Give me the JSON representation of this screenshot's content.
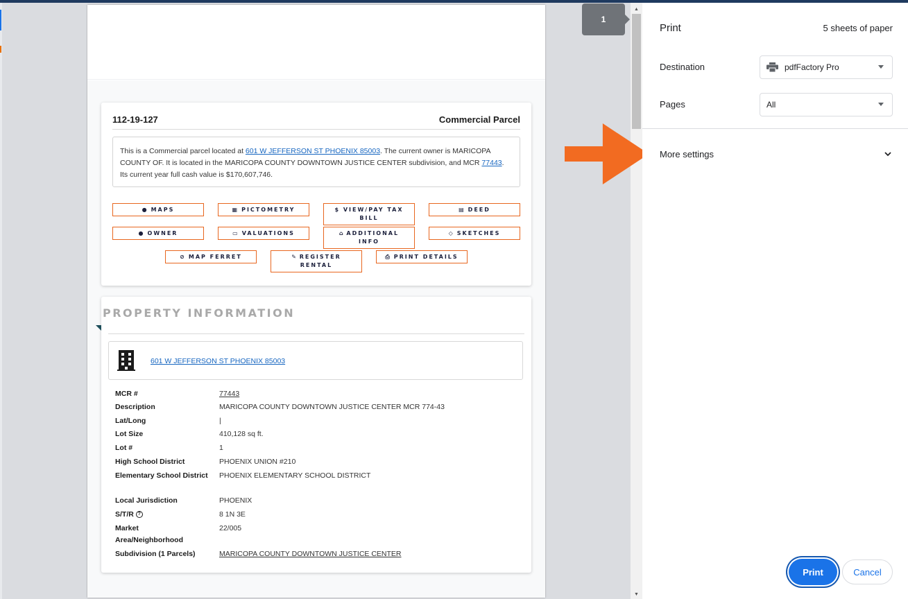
{
  "preview": {
    "parcel": {
      "number": "112-19-127",
      "type": "Commercial Parcel",
      "summary_pre": "This is a Commercial parcel located at ",
      "summary_address": "601 W JEFFERSON ST PHOENIX 85003",
      "summary_mid": ". The current owner is MARICOPA COUNTY OF. It is located in the MARICOPA COUNTY DOWNTOWN JUSTICE CENTER subdivision, and MCR ",
      "summary_mcr": "77443",
      "summary_post": ". Its current year full cash value is $170,607,746."
    },
    "buttons": {
      "maps": "Maps",
      "pictometry": "Pictometry",
      "tax_line1": "$ View/Pay Tax",
      "tax_line2": "Bill",
      "deed": "Deed",
      "owner": "Owner",
      "valuations": "Valuations",
      "additional_line1": "Additional",
      "additional_line2": "Info",
      "sketches": "Sketches",
      "map_ferret": "Map Ferret",
      "register_line1": "Register",
      "register_line2": "Rental",
      "print_details": "Print Details"
    },
    "property": {
      "title": "PROPERTY INFORMATION",
      "address": "601 W JEFFERSON ST PHOENIX 85003",
      "rows": [
        {
          "label": "MCR #",
          "value": "77443"
        },
        {
          "label": "Description",
          "value": "MARICOPA COUNTY DOWNTOWN JUSTICE CENTER MCR 774-43"
        },
        {
          "label": "Lat/Long",
          "value": "|"
        },
        {
          "label": "Lot Size",
          "value": "410,128 sq ft."
        },
        {
          "label": "Lot #",
          "value": "1"
        },
        {
          "label": "High School District",
          "value": "PHOENIX UNION #210"
        },
        {
          "label": "Elementary School District",
          "value": "PHOENIX ELEMENTARY SCHOOL DISTRICT"
        },
        {
          "label": "Local Jurisdiction",
          "value": "PHOENIX"
        },
        {
          "label": "S/T/R",
          "value": "8 1N 3E"
        },
        {
          "label": "Market Area/Neighborhood",
          "value": "22/005"
        },
        {
          "label": "Subdivision (1 Parcels)",
          "value": "MARICOPA COUNTY DOWNTOWN JUSTICE CENTER"
        }
      ]
    }
  },
  "page_indicator": "1",
  "print_panel": {
    "title": "Print",
    "sheets": "5 sheets of paper",
    "destination_label": "Destination",
    "destination_value": "pdfFactory Pro",
    "pages_label": "Pages",
    "pages_value": "All",
    "more_settings": "More settings",
    "print_button": "Print",
    "cancel_button": "Cancel"
  },
  "colors": {
    "accent_orange": "#e8661e",
    "arrow_orange": "#f26b21",
    "chrome_blue": "#1a73e8",
    "link_blue": "#1565c0"
  }
}
